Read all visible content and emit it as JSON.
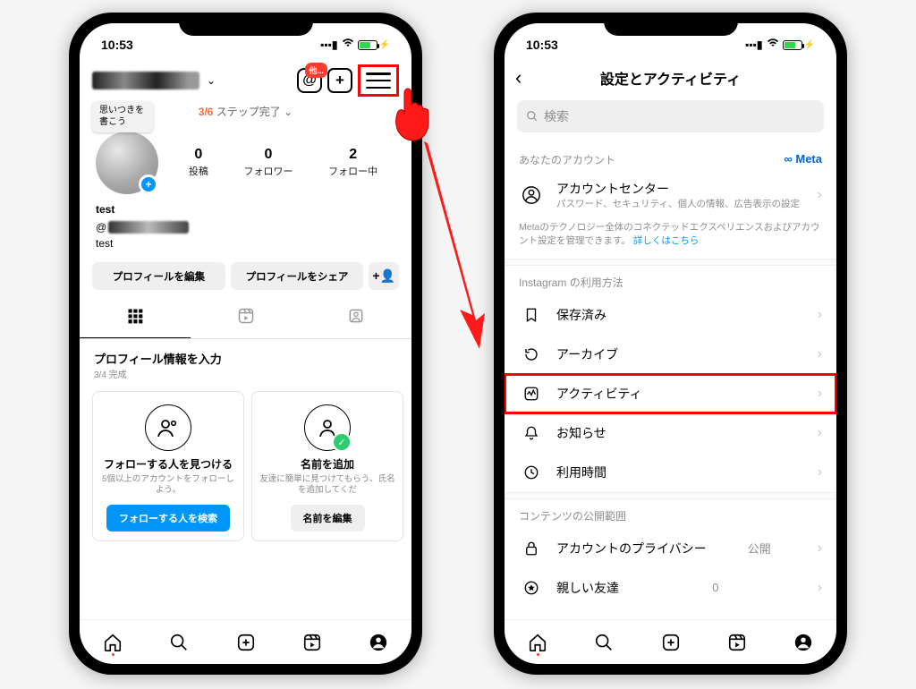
{
  "status": {
    "time": "10:53"
  },
  "left": {
    "header": {
      "threads_badge": "他...",
      "chevron": "⌄"
    },
    "steps": {
      "fraction": "3/6",
      "label": "ステップ完了"
    },
    "tooltip": "思いつきを書こう",
    "stats": {
      "posts": {
        "value": "0",
        "label": "投稿"
      },
      "followers": {
        "value": "0",
        "label": "フォロワー"
      },
      "following": {
        "value": "2",
        "label": "フォロー中"
      }
    },
    "bio": {
      "name": "test",
      "test2": "test"
    },
    "buttons": {
      "edit": "プロフィールを編集",
      "share": "プロフィールをシェア"
    },
    "prompt": {
      "title": "プロフィール情報を入力",
      "sub": "3/4 完成"
    },
    "cards": {
      "c1": {
        "title": "フォローする人を見つける",
        "sub": "5個以上のアカウントをフォローしよう。",
        "btn": "フォローする人を検索"
      },
      "c2": {
        "title": "名前を追加",
        "sub": "友達に簡単に見つけてもらう、氏名を追加してくだ",
        "btn": "名前を編集"
      }
    }
  },
  "right": {
    "title": "設定とアクティビティ",
    "search_placeholder": "検索",
    "section1": "あなたのアカウント",
    "meta": "Meta",
    "account_center": {
      "title": "アカウントセンター",
      "sub": "パスワード、セキュリティ、個人の情報、広告表示の設定"
    },
    "meta_note": "Metaのテクノロジー全体のコネクテッドエクスペリエンスおよびアカウント設定を管理できます。",
    "meta_link": "詳しくはこちら",
    "section2": "Instagram の利用方法",
    "rows": {
      "saved": "保存済み",
      "archive": "アーカイブ",
      "activity": "アクティビティ",
      "notifications": "お知らせ",
      "screentime": "利用時間"
    },
    "section3": "コンテンツの公開範囲",
    "privacy": {
      "label": "アカウントのプライバシー",
      "value": "公開"
    },
    "close_friends": {
      "label": "親しい友達",
      "value": "0"
    }
  }
}
